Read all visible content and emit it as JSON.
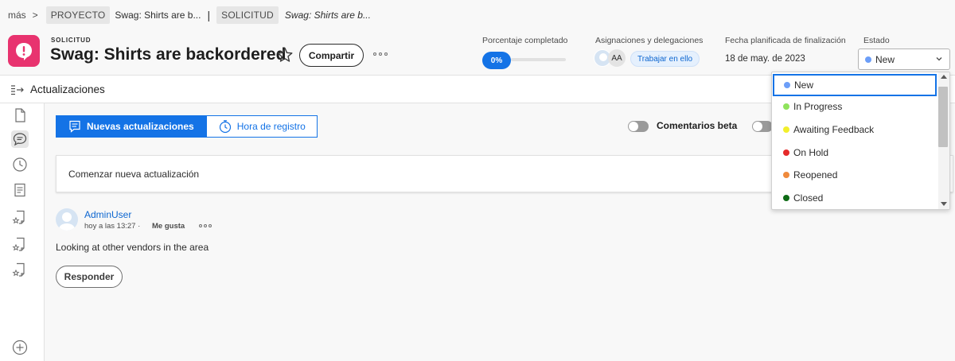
{
  "breadcrumb": {
    "more": "más",
    "separator": ">",
    "project_chip": "PROYECTO",
    "project_name": "Swag: Shirts are b...",
    "divider": "|",
    "request_chip": "SOLICITUD",
    "request_name": "Swag: Shirts are b..."
  },
  "header": {
    "object_type": "SOLICITUD",
    "title": "Swag: Shirts are backordered",
    "share_label": "Compartir",
    "logo_color": "#e8336f"
  },
  "fields": {
    "percent_label": "Porcentaje completado",
    "percent_value": "0%",
    "percent_fraction": 0,
    "assignments_label": "Asignaciones y delegaciones",
    "assignee_initials": "AA",
    "work_on_it": "Trabajar en ello",
    "planned_date_label": "Fecha planificada de finalización",
    "planned_date_value": "18 de may. de 2023",
    "status_label": "Estado",
    "status_value": "New",
    "status_color": "#6c9ef8"
  },
  "section": {
    "title": "Actualizaciones"
  },
  "tabs": [
    {
      "label": "Nuevas actualizaciones",
      "icon": "updates-icon",
      "active": true
    },
    {
      "label": "Hora de registro",
      "icon": "stopwatch-icon",
      "active": false
    }
  ],
  "toggles": {
    "beta_comments": "Comentarios beta"
  },
  "composer": {
    "placeholder": "Comenzar nueva actualización"
  },
  "comment": {
    "author": "AdminUser",
    "time": "hoy a las 13:27 ·",
    "like": "Me gusta",
    "text": "Looking at other vendors in the area",
    "reply": "Responder"
  },
  "status_dropdown": {
    "options": [
      {
        "label": "New",
        "color": "#6c9ef8",
        "selected": true
      },
      {
        "label": "In Progress",
        "color": "#8fe35c"
      },
      {
        "label": "Awaiting Feedback",
        "color": "#f2ef2c"
      },
      {
        "label": "On Hold",
        "color": "#e52b2b"
      },
      {
        "label": "Reopened",
        "color": "#ef8a3c"
      },
      {
        "label": "Closed",
        "color": "#0e6b15"
      }
    ]
  }
}
